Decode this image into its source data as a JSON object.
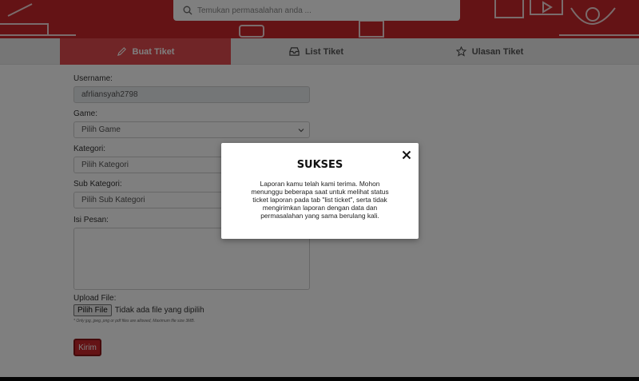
{
  "header": {
    "search": {
      "placeholder": "Temukan permasalahan anda ..."
    }
  },
  "tabs": [
    {
      "label": "Buat Tiket",
      "icon": "pencil-icon",
      "active": true
    },
    {
      "label": "List Tiket",
      "icon": "inbox-icon",
      "active": false
    },
    {
      "label": "Ulasan Tiket",
      "icon": "star-icon",
      "active": false
    }
  ],
  "form": {
    "username_label": "Username:",
    "username_value": "afrliansyah2798",
    "game_label": "Game:",
    "game_value": "Pilih Game",
    "kategori_label": "Kategori:",
    "kategori_value": "Pilih Kategori",
    "subkategori_label": "Sub Kategori:",
    "subkategori_value": "Pilih Sub Kategori",
    "pesan_label": "Isi Pesan:",
    "upload_label": "Upload File:",
    "upload_button": "Pilih File",
    "upload_status": "Tidak ada file yang dipilih",
    "upload_hint": "* Only jpg, jpeg, png or pdf files are allowed, Maximum file size 3MB.",
    "submit_label": "Kirim"
  },
  "modal": {
    "title": "SUKSES",
    "message": "Laporan kamu telah kami terima. Mohon menunggu beberapa saat untuk melihat status ticket laporan pada tab \"list ticket\", serta tidak mengirimkan laporan dengan data dan permasalahan yang sama berulang kali.",
    "close_icon": "close-icon"
  },
  "colors": {
    "brand": "#c8262a",
    "active_tab": "#e04a4e",
    "overlay": "rgba(0,0,0,0.5)"
  }
}
